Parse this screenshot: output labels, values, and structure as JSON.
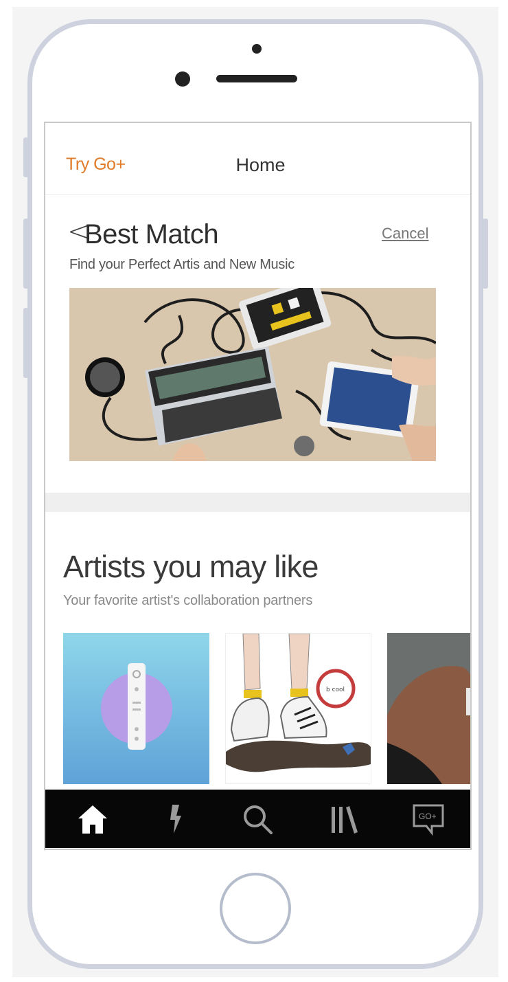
{
  "header": {
    "promo_label": "Try Go+",
    "title": "Home"
  },
  "best_match": {
    "back_glyph": "<",
    "title": "Best Match",
    "cancel_label": "Cancel",
    "subtitle": "Find your Perfect Artis and New Music",
    "banner_icon": "music-gear-photo"
  },
  "artists": {
    "title": "Artists you may like",
    "subtitle": "Your favorite artist's collaboration partners",
    "cards": [
      {
        "icon": "remote-on-purple-circle-art"
      },
      {
        "icon": "sneakers-sketch-art",
        "caption": "b cool"
      },
      {
        "icon": "portrait-photo"
      }
    ]
  },
  "tab_bar": {
    "items": [
      {
        "icon": "home-icon",
        "active": true
      },
      {
        "icon": "lightning-icon",
        "active": false
      },
      {
        "icon": "search-icon",
        "active": false
      },
      {
        "icon": "library-icon",
        "active": false
      },
      {
        "icon": "go-plus-icon",
        "label": "GO+",
        "active": false
      }
    ]
  },
  "colors": {
    "accent": "#e07b2a",
    "tab_bar_bg": "#070707",
    "phone_frame": "#cdd2de"
  }
}
